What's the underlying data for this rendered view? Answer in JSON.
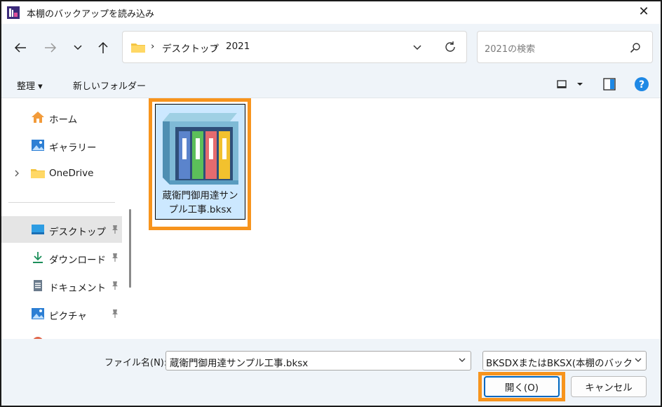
{
  "window": {
    "title": "本棚のバックアップを読み込み",
    "close_glyph": "✕"
  },
  "address": {
    "separator": "›",
    "crumbs": [
      "デスクトップ",
      "2021"
    ],
    "search_placeholder": "2021の検索"
  },
  "toolbar": {
    "organize_label": "整理 ▾",
    "new_folder_label": "新しいフォルダー"
  },
  "sidebar": {
    "items": [
      {
        "label": "ホーム"
      },
      {
        "label": "ギャラリー"
      },
      {
        "label": "OneDrive"
      },
      {
        "label": "デスクトップ"
      },
      {
        "label": "ダウンロード"
      },
      {
        "label": "ドキュメント"
      },
      {
        "label": "ピクチャ"
      }
    ]
  },
  "file": {
    "name_line1": "蔵衛門御用達サン",
    "name_line2": "プル工事.bksx"
  },
  "footer": {
    "filename_label": "ファイル名(N):",
    "filename_value": "蔵衛門御用達サンプル工事.bksx",
    "filetype_value": "BKSDXまたはBKSX(本棚のバックアップ",
    "open_label": "開く(O)",
    "cancel_label": "キャンセル"
  },
  "colors": {
    "highlight": "#f7941d",
    "accent": "#0067c0",
    "selection": "#cce8ff"
  }
}
